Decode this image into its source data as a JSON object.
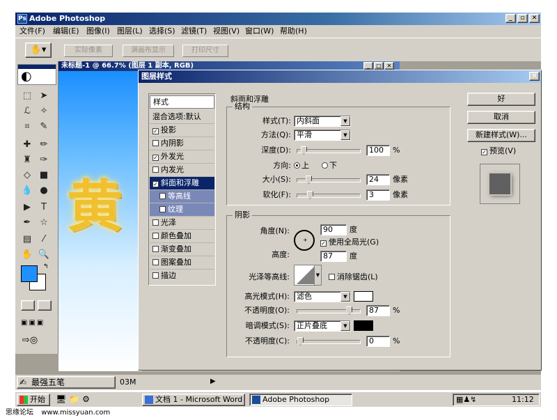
{
  "app": {
    "title": "Adobe Photoshop",
    "window_controls": [
      "_",
      "▫",
      "✕"
    ],
    "menus": [
      "文件(F)",
      "编辑(E)",
      "图像(I)",
      "图层(L)",
      "选择(S)",
      "滤镜(T)",
      "视图(V)",
      "窗口(W)",
      "帮助(H)"
    ]
  },
  "options_bar": {
    "buttons": [
      "实际像素",
      "满画布显示",
      "打印尺寸"
    ]
  },
  "document": {
    "title": "未标题-1 @ 66.7% (图层 1 副本, RGB)",
    "canvas_text": "黄"
  },
  "dialog": {
    "title": "图层样式",
    "close": "✕",
    "style_list": {
      "header": "样式",
      "blend": "混合选项:默认",
      "items": [
        {
          "label": "投影",
          "checked": true
        },
        {
          "label": "内阴影",
          "checked": false
        },
        {
          "label": "外发光",
          "checked": true
        },
        {
          "label": "内发光",
          "checked": false
        },
        {
          "label": "斜面和浮雕",
          "checked": true,
          "selected": true
        },
        {
          "label": "等高线",
          "checked": false,
          "sub": true
        },
        {
          "label": "纹理",
          "checked": false,
          "sub": true
        },
        {
          "label": "光泽",
          "checked": false
        },
        {
          "label": "颜色叠加",
          "checked": false
        },
        {
          "label": "渐变叠加",
          "checked": false
        },
        {
          "label": "图案叠加",
          "checked": false
        },
        {
          "label": "描边",
          "checked": false
        }
      ]
    },
    "bevel": {
      "group_title": "斜面和浮雕",
      "structure_title": "结构",
      "style_label": "样式(T):",
      "style_value": "内斜面",
      "technique_label": "方法(Q):",
      "technique_value": "平滑",
      "depth_label": "深度(D):",
      "depth_value": "100",
      "depth_unit": "%",
      "depth_level": 0.06,
      "direction_label": "方向:",
      "direction_up": "上",
      "direction_down": "下",
      "size_label": "大小(S):",
      "size_value": "24",
      "size_unit": "像素",
      "size_level": 0.15,
      "soften_label": "软化(F):",
      "soften_value": "3",
      "soften_unit": "像素",
      "soften_level": 0.17
    },
    "shading": {
      "title": "阴影",
      "angle_label": "角度(N):",
      "angle_value": "90",
      "angle_unit": "度",
      "global_light_label": "使用全局光(G)",
      "global_light_checked": true,
      "altitude_label": "高度:",
      "altitude_value": "87",
      "altitude_unit": "度",
      "gloss_label": "光泽等高线:",
      "antialias_label": "消除锯齿(L)",
      "antialias_checked": false,
      "highlight_mode_label": "高光模式(H):",
      "highlight_mode_value": "滤色",
      "highlight_color": "#ffffff",
      "highlight_opacity_label": "不透明度(O):",
      "highlight_opacity_value": "87",
      "highlight_opacity_unit": "%",
      "highlight_opacity_level": 0.87,
      "shadow_mode_label": "暗调模式(S):",
      "shadow_mode_value": "正片叠底",
      "shadow_color": "#000000",
      "shadow_opacity_label": "不透明度(C):",
      "shadow_opacity_value": "0",
      "shadow_opacity_unit": "%",
      "shadow_opacity_level": 0.0
    },
    "buttons": {
      "ok": "好",
      "cancel": "取消",
      "new_style": "新建样式(W)...",
      "preview_label": "预览(V)",
      "preview_checked": true
    }
  },
  "statusbar": {
    "ime": "最强五笔",
    "doc_size": "03M"
  },
  "taskbar": {
    "start": "开始",
    "tasks": [
      "文档 1 - Microsoft Word",
      "Adobe Photoshop"
    ],
    "clock": "11:12"
  },
  "footer": {
    "site_name": "思缘论坛",
    "site_url": "www.missyuan.com"
  },
  "colors": {
    "foreground": "#1e90ff",
    "background": "#ffffff",
    "accent": "#0a246a"
  }
}
